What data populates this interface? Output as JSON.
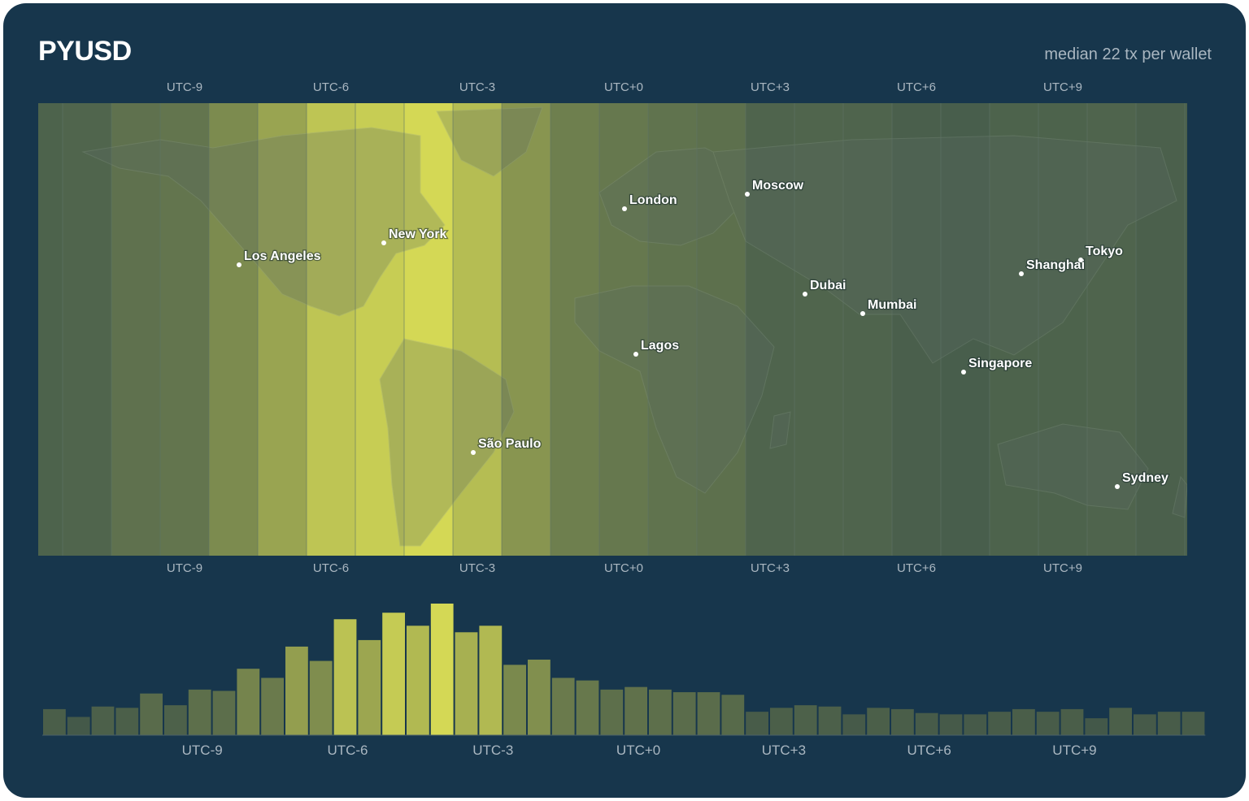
{
  "header": {
    "title": "PYUSD",
    "subtitle": "median 22 tx per wallet"
  },
  "timezone_ticks": [
    "UTC-9",
    "UTC-6",
    "UTC-3",
    "UTC+0",
    "UTC+3",
    "UTC+6",
    "UTC+9"
  ],
  "map": {
    "cities": [
      {
        "name": "Los Angeles",
        "tz": "UTC-8"
      },
      {
        "name": "New York",
        "tz": "UTC-5"
      },
      {
        "name": "São Paulo",
        "tz": "UTC-3"
      },
      {
        "name": "London",
        "tz": "UTC+0"
      },
      {
        "name": "Moscow",
        "tz": "UTC+3"
      },
      {
        "name": "Lagos",
        "tz": "UTC+1"
      },
      {
        "name": "Dubai",
        "tz": "UTC+4"
      },
      {
        "name": "Mumbai",
        "tz": "UTC+5:30"
      },
      {
        "name": "Singapore",
        "tz": "UTC+8"
      },
      {
        "name": "Shanghai",
        "tz": "UTC+8"
      },
      {
        "name": "Tokyo",
        "tz": "UTC+9"
      },
      {
        "name": "Sydney",
        "tz": "UTC+10"
      }
    ],
    "colors": {
      "low": "#374f4b",
      "high": "#d4d855",
      "land_overlay": "#5b6a63",
      "grid": "#5e7366"
    }
  },
  "chart_data": {
    "type": "bar",
    "title": "PYUSD",
    "subtitle": "median 22 tx per wallet",
    "x_unit": "UTC offset (half-hour bins)",
    "x": [
      -12,
      -11.5,
      -11,
      -10.5,
      -10,
      -9.5,
      -9,
      -8.5,
      -8,
      -7.5,
      -7,
      -6.5,
      -6,
      -5.5,
      -5,
      -4.5,
      -4,
      -3.5,
      -3,
      -2.5,
      -2,
      -1.5,
      -1,
      -0.5,
      0,
      0.5,
      1,
      1.5,
      2,
      2.5,
      3,
      3.5,
      4,
      4.5,
      5,
      5.5,
      6,
      6.5,
      7,
      7.5,
      8,
      8.5,
      9,
      9.5,
      10,
      10.5,
      11,
      11.5
    ],
    "values": [
      20,
      14,
      22,
      21,
      32,
      23,
      35,
      34,
      51,
      44,
      68,
      57,
      89,
      73,
      94,
      84,
      101,
      79,
      84,
      54,
      58,
      44,
      42,
      35,
      37,
      35,
      33,
      33,
      31,
      18,
      21,
      23,
      22,
      16,
      21,
      20,
      17,
      16,
      16,
      18,
      20,
      18,
      20,
      13,
      21,
      16,
      18,
      18
    ],
    "xticks": [
      "UTC-9",
      "UTC-6",
      "UTC-3",
      "UTC+0",
      "UTC+3",
      "UTC+6",
      "UTC+9"
    ],
    "ylim": [
      0,
      101
    ],
    "color_scale": [
      "#3a5048",
      "#d4d855"
    ],
    "grid": false,
    "legend": "none"
  }
}
